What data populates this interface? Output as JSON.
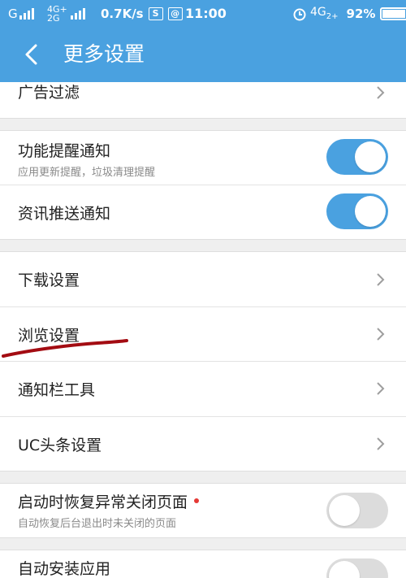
{
  "status_bar": {
    "carrier1": "G",
    "carrier2_top": "4G+",
    "carrier2_bottom": "2G",
    "speed": "0.7K/s",
    "time": "11:00",
    "net_top": "4G",
    "net_sub": "2+",
    "battery": "92%",
    "battery_level": 0.92,
    "app_icon1": "S",
    "app_icon2": "@"
  },
  "appbar": {
    "title": "更多设置",
    "back_icon": "chevron-left-icon"
  },
  "colors": {
    "accent": "#4aa1e0",
    "toggle_off": "#dcdcdc",
    "dot": "#e53935",
    "annotation": "#a30c12"
  },
  "rows": {
    "ad_filter": {
      "label": "广告过滤"
    },
    "feature_notify": {
      "label": "功能提醒通知",
      "sub": "应用更新提醒，垃圾清理提醒",
      "on": true
    },
    "news_push": {
      "label": "资讯推送通知",
      "on": true
    },
    "download": {
      "label": "下载设置"
    },
    "browse": {
      "label": "浏览设置"
    },
    "notify_tools": {
      "label": "通知栏工具"
    },
    "uc_headlines": {
      "label": "UC头条设置"
    },
    "restore_pages": {
      "label": "启动时恢复异常关闭页面",
      "sub": "自动恢复后台退出时未关闭的页面",
      "on": false
    },
    "auto_install": {
      "label": "自动安装应用",
      "on": false
    }
  }
}
